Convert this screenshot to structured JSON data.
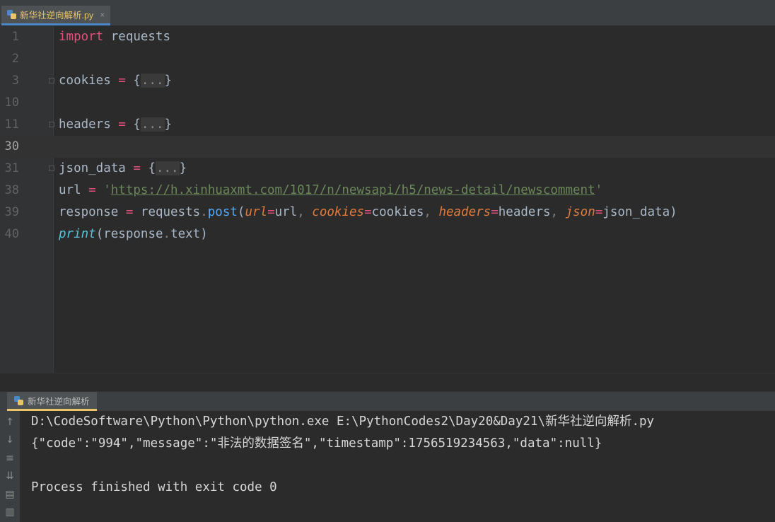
{
  "tab": {
    "label": "新华社逆向解析.py",
    "close": "×"
  },
  "editor": {
    "lines": [
      {
        "num": "1"
      },
      {
        "num": "2"
      },
      {
        "num": "3"
      },
      {
        "num": "10"
      },
      {
        "num": "11"
      },
      {
        "num": "30"
      },
      {
        "num": "31"
      },
      {
        "num": "38"
      },
      {
        "num": "39"
      },
      {
        "num": "40"
      }
    ],
    "code": {
      "l1_kw": "import",
      "l1_mod": " requests",
      "l3_var": "cookies",
      "eq": " = ",
      "brace_open": "{",
      "folded": "...",
      "brace_close": "}",
      "l11_var": "headers",
      "l31_var": "json_data",
      "l38_var": "url",
      "quote": "'",
      "l38_url": "https://h.xinhuaxmt.com/1017/n/newsapi/h5/news-detail/newscomment",
      "l39_var": "response",
      "l39_obj": "requests",
      "dot": ".",
      "l39_fn": "post",
      "paren_open": "(",
      "paren_close": ")",
      "comma": ", ",
      "p_url": "url",
      "eq_nospace": "=",
      "v_url": "url",
      "p_cookies": "cookies",
      "v_cookies": "cookies",
      "p_headers": "headers",
      "v_headers": "headers",
      "p_json": "json",
      "v_json": "json_data",
      "l40_fn": "print",
      "l40_obj": "response",
      "l40_attr": "text"
    }
  },
  "run": {
    "tab_label": "新华社逆向解析",
    "console": [
      "D:\\CodeSoftware\\Python\\Python\\python.exe E:\\PythonCodes2\\Day20&Day21\\新华社逆向解析.py",
      "{\"code\":\"994\",\"message\":\"非法的数据签名\",\"timestamp\":1756519234563,\"data\":null}",
      "",
      "Process finished with exit code 0"
    ]
  }
}
